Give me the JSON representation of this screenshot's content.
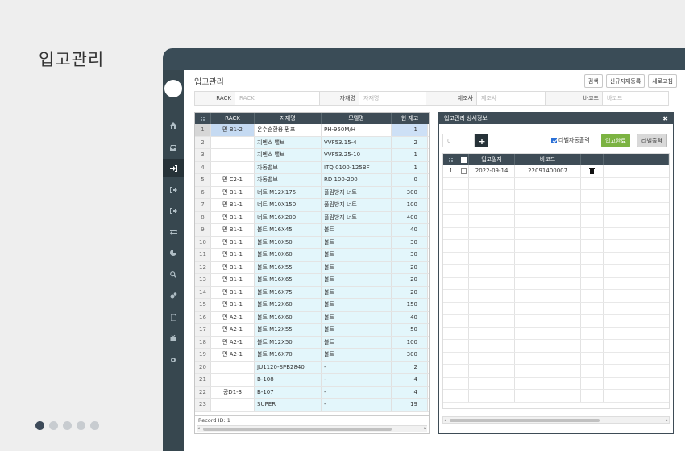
{
  "outer_title": "입고관리",
  "pager": {
    "total": 5,
    "active": 0
  },
  "sidebar": {
    "icons": [
      "home-icon",
      "inbox-icon",
      "sign-in-icon",
      "sign-out-icon",
      "sign-out-icon-2",
      "exchange-icon",
      "pie-chart-icon",
      "search-plus-icon",
      "cogs-icon",
      "document-icon",
      "gift-icon",
      "gear-icon"
    ],
    "active_index": 2
  },
  "page": {
    "title": "입고관리",
    "buttons": {
      "search": "검색",
      "new_item": "신규자재등록",
      "refresh": "새로고침"
    }
  },
  "filters": {
    "rack_label": "RACK",
    "rack_placeholder": "RACK",
    "name_label": "자재명",
    "name_placeholder": "자재명",
    "maker_label": "제조사",
    "maker_placeholder": "제조사",
    "barcode_label": "바코드",
    "barcode_placeholder": "바코드"
  },
  "grid": {
    "columns": [
      "RACK",
      "자재명",
      "모델명",
      "현 재고"
    ],
    "rows": [
      {
        "no": "1",
        "rack": "면 B1-2",
        "name": "온수순환용 펌프",
        "model": "PH-950M/H",
        "stock": "1"
      },
      {
        "no": "2",
        "rack": "",
        "name": "지멘스 밸브",
        "model": "VVF53.15-4",
        "stock": "2"
      },
      {
        "no": "3",
        "rack": "",
        "name": "지멘스 밸브",
        "model": "VVF53.25-10",
        "stock": "1"
      },
      {
        "no": "4",
        "rack": "",
        "name": "자동밸브",
        "model": "ITQ 0100-125BF",
        "stock": "1"
      },
      {
        "no": "5",
        "rack": "면 C2-1",
        "name": "자동밸브",
        "model": "RD 100-200",
        "stock": "0"
      },
      {
        "no": "6",
        "rack": "면 B1-1",
        "name": "너트 M12X175",
        "model": "풀림방지 너트",
        "stock": "300"
      },
      {
        "no": "7",
        "rack": "면 B1-1",
        "name": "너트 M10X150",
        "model": "풀림방지 너트",
        "stock": "100"
      },
      {
        "no": "8",
        "rack": "면 B1-1",
        "name": "너트 M16X200",
        "model": "풀림방지 너트",
        "stock": "400"
      },
      {
        "no": "9",
        "rack": "면 B1-1",
        "name": "볼트 M16X45",
        "model": "볼트",
        "stock": "40"
      },
      {
        "no": "10",
        "rack": "면 B1-1",
        "name": "볼트 M10X50",
        "model": "볼트",
        "stock": "30"
      },
      {
        "no": "11",
        "rack": "면 B1-1",
        "name": "볼트 M10X60",
        "model": "볼트",
        "stock": "30"
      },
      {
        "no": "12",
        "rack": "면 B1-1",
        "name": "볼트 M16X55",
        "model": "볼트",
        "stock": "20"
      },
      {
        "no": "13",
        "rack": "면 B1-1",
        "name": "볼트 M16X65",
        "model": "볼트",
        "stock": "20"
      },
      {
        "no": "14",
        "rack": "면 B1-1",
        "name": "볼트 M16X75",
        "model": "볼트",
        "stock": "20"
      },
      {
        "no": "15",
        "rack": "면 B1-1",
        "name": "볼트 M12X60",
        "model": "볼트",
        "stock": "150"
      },
      {
        "no": "16",
        "rack": "면 A2-1",
        "name": "볼트 M16X60",
        "model": "볼트",
        "stock": "40"
      },
      {
        "no": "17",
        "rack": "면 A2-1",
        "name": "볼트 M12X55",
        "model": "볼트",
        "stock": "50"
      },
      {
        "no": "18",
        "rack": "면 A2-1",
        "name": "볼트 M12X50",
        "model": "볼트",
        "stock": "100"
      },
      {
        "no": "19",
        "rack": "면 A2-1",
        "name": "볼트 M16X70",
        "model": "볼트",
        "stock": "300"
      },
      {
        "no": "20",
        "rack": "",
        "name": "JU1120-SPB2840",
        "model": "-",
        "stock": "2"
      },
      {
        "no": "21",
        "rack": "",
        "name": "B-108",
        "model": "-",
        "stock": "4"
      },
      {
        "no": "22",
        "rack": "공D1-3",
        "name": "B-107",
        "model": "-",
        "stock": "4"
      },
      {
        "no": "23",
        "rack": "",
        "name": "SUPER",
        "model": "-",
        "stock": "19"
      }
    ],
    "selected_index": 0,
    "footer": "Record ID: 1"
  },
  "detail": {
    "title": "입고관리 상세정보",
    "qty_placeholder": "0",
    "label_checkbox": "라벨자동출력",
    "label_checked": true,
    "complete_button": "입고완료",
    "print_button": "라벨출력",
    "columns": [
      "입고일자",
      "바코드"
    ],
    "rows": [
      {
        "no": "1",
        "date": "2022-09-14",
        "barcode": "22091400007"
      }
    ],
    "accent_green": "#7cb342"
  }
}
